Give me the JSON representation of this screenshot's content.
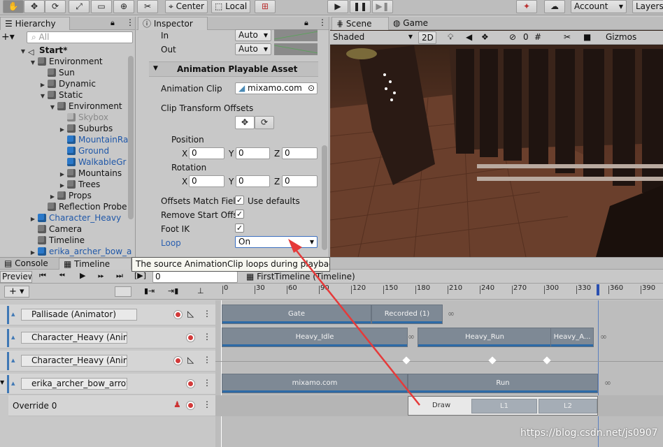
{
  "toolbar": {
    "center": "Center",
    "local": "Local",
    "account": "Account",
    "layers": "Layers"
  },
  "hierarchy": {
    "title": "Hierarchy",
    "search_placeholder": "All",
    "items": [
      {
        "label": "Start*",
        "depth": 0,
        "arrow": "down",
        "icon": "unity"
      },
      {
        "label": "Environment",
        "depth": 1,
        "arrow": "down",
        "icon": "cube-gray"
      },
      {
        "label": "Sun",
        "depth": 2,
        "arrow": "",
        "icon": "cube-gray"
      },
      {
        "label": "Dynamic",
        "depth": 2,
        "arrow": "right",
        "icon": "cube-gray"
      },
      {
        "label": "Static",
        "depth": 2,
        "arrow": "down",
        "icon": "cube-gray"
      },
      {
        "label": "Environment",
        "depth": 3,
        "arrow": "down",
        "icon": "cube-gray"
      },
      {
        "label": "Skybox",
        "depth": 4,
        "arrow": "",
        "icon": "cube-light"
      },
      {
        "label": "Suburbs",
        "depth": 4,
        "arrow": "right",
        "icon": "cube-gray"
      },
      {
        "label": "MountainRa",
        "depth": 4,
        "arrow": "",
        "icon": "cube-blue"
      },
      {
        "label": "Ground",
        "depth": 4,
        "arrow": "",
        "icon": "cube-blue"
      },
      {
        "label": "WalkableGr",
        "depth": 4,
        "arrow": "",
        "icon": "cube-blue"
      },
      {
        "label": "Mountains",
        "depth": 4,
        "arrow": "right",
        "icon": "cube-gray"
      },
      {
        "label": "Trees",
        "depth": 4,
        "arrow": "right",
        "icon": "cube-gray"
      },
      {
        "label": "Props",
        "depth": 3,
        "arrow": "right",
        "icon": "cube-gray"
      },
      {
        "label": "Reflection Probe",
        "depth": 2,
        "arrow": "",
        "icon": "cube-gray"
      },
      {
        "label": "Character_Heavy",
        "depth": 1,
        "arrow": "right",
        "icon": "cube-blue"
      },
      {
        "label": "Camera",
        "depth": 1,
        "arrow": "",
        "icon": "cube-gray"
      },
      {
        "label": "Timeline",
        "depth": 1,
        "arrow": "",
        "icon": "cube-gray"
      },
      {
        "label": "erika_archer_bow_a",
        "depth": 1,
        "arrow": "right",
        "icon": "cube-blue"
      }
    ]
  },
  "inspector": {
    "title": "Inspector",
    "in_label": "In",
    "in_value": "Auto",
    "out_label": "Out",
    "out_value": "Auto",
    "section": "Animation Playable Asset",
    "clip_label": "Animation Clip",
    "clip_value": "mixamo.com",
    "offsets_label": "Clip Transform Offsets",
    "position_label": "Position",
    "rotation_label": "Rotation",
    "x": "X",
    "y": "Y",
    "z": "Z",
    "px": "0",
    "py": "0",
    "pz": "0",
    "rx": "0",
    "ry": "0",
    "rz": "0",
    "match_label": "Offsets Match Field",
    "use_defaults": "Use defaults",
    "remove_label": "Remove Start Offset",
    "footik_label": "Foot IK",
    "loop_label": "Loop",
    "loop_value": "On"
  },
  "scene": {
    "tab_scene": "Scene",
    "tab_game": "Game",
    "shaded": "Shaded",
    "mode2d": "2D",
    "hidden_count": "0",
    "gizmos": "Gizmos"
  },
  "tooltip": "The source AnimationClip loops during playback.",
  "bottom_tabs": {
    "console": "Console",
    "timeline": "Timeline"
  },
  "timeline": {
    "preview": "Preview",
    "frame": "0",
    "asset": "FirstTimeline (Timeline)",
    "ruler": [
      "0",
      "30",
      "60",
      "90",
      "120",
      "150",
      "180",
      "210",
      "240",
      "270",
      "300",
      "330",
      "360",
      "390"
    ],
    "tracks": [
      "Pallisade (Animator)",
      "Character_Heavy (Anim",
      "Character_Heavy (Anim",
      "erika_archer_bow_arrow"
    ],
    "override": "Override 0",
    "clips": {
      "gate": "Gate",
      "recorded": "Recorded (1)",
      "idle": "Heavy_Idle",
      "run": "Heavy_Run",
      "heavyA": "Heavy_A...",
      "mixamo": "mixamo.com",
      "run2": "Run",
      "draw": "Draw",
      "l1": "L1",
      "l2": "L2"
    }
  },
  "watermark": "https://blog.csdn.net/js0907",
  "colors": {
    "accent": "#3f78b5",
    "clip": "#7e8995",
    "record": "#d23a3a",
    "arrow": "#e53a3a"
  }
}
